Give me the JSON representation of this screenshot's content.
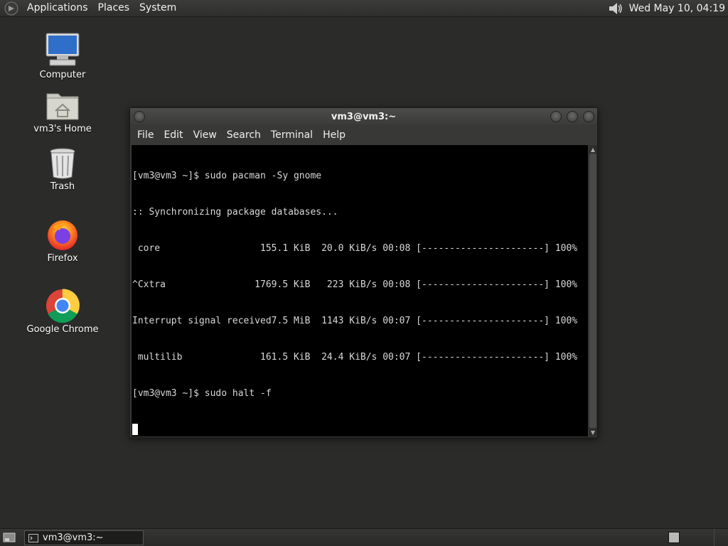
{
  "top_panel": {
    "menus": [
      "Applications",
      "Places",
      "System"
    ],
    "clock": "Wed May 10, 04:19"
  },
  "desktop": {
    "icons": [
      {
        "label": "Computer",
        "icon": "computer-icon"
      },
      {
        "label": "vm3's Home",
        "icon": "home-folder-icon"
      },
      {
        "label": "Trash",
        "icon": "trash-icon"
      },
      {
        "label": "Firefox",
        "icon": "firefox-icon"
      },
      {
        "label": "Google Chrome",
        "icon": "chrome-icon"
      }
    ]
  },
  "terminal": {
    "title": "vm3@vm3:~",
    "menus": [
      "File",
      "Edit",
      "View",
      "Search",
      "Terminal",
      "Help"
    ],
    "lines": [
      "[vm3@vm3 ~]$ sudo pacman -Sy gnome",
      ":: Synchronizing package databases...",
      " core                  155.1 KiB  20.0 KiB/s 00:08 [----------------------] 100%",
      "^Cxtra                1769.5 KiB   223 KiB/s 00:08 [----------------------] 100%",
      "Interrupt signal received7.5 MiB  1143 KiB/s 00:07 [----------------------] 100%",
      " multilib              161.5 KiB  24.4 KiB/s 00:07 [----------------------] 100%",
      "[vm3@vm3 ~]$ sudo halt -f"
    ]
  },
  "bottom_panel": {
    "task_label": "vm3@vm3:~"
  },
  "colors": {
    "desktop_bg": "#2b2c2a",
    "terminal_bg": "#000000",
    "terminal_fg": "#d8d8d8"
  }
}
